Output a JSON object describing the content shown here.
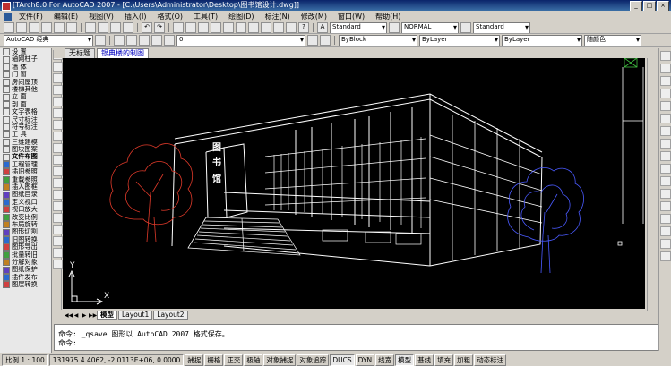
{
  "window": {
    "title": "[TArch8.0 For AutoCAD 2007 - [C:\\Users\\Administrator\\Desktop\\图书馆设计.dwg]]"
  },
  "menu": [
    "文件(F)",
    "编辑(E)",
    "视图(V)",
    "插入(I)",
    "格式(O)",
    "工具(T)",
    "绘图(D)",
    "标注(N)",
    "修改(M)",
    "窗口(W)",
    "帮助(H)"
  ],
  "toolbar1": {
    "text_style": "Standard",
    "dim_style": "NORMAL",
    "table_style": "Standard"
  },
  "toolbar2": {
    "workspace": "AutoCAD 经典",
    "layer": "0",
    "color": "ByBlock",
    "linetype": "ByLayer",
    "lineweight": "ByLayer",
    "plotstyle": "随颜色"
  },
  "doc_tabs": [
    "无标题",
    "银典楼的制图"
  ],
  "sidebar": {
    "items": [
      {
        "label": "设  置",
        "hdr": false
      },
      {
        "label": "轴网柱子",
        "hdr": false
      },
      {
        "label": "墙  体",
        "hdr": false
      },
      {
        "label": "门  窗",
        "hdr": false
      },
      {
        "label": "房间屋顶",
        "hdr": false
      },
      {
        "label": "楼梯其他",
        "hdr": false
      },
      {
        "label": "立  面",
        "hdr": false
      },
      {
        "label": "剖  面",
        "hdr": false
      },
      {
        "label": "文字表格",
        "hdr": false
      },
      {
        "label": "尺寸标注",
        "hdr": false
      },
      {
        "label": "符号标注",
        "hdr": false
      },
      {
        "label": "工  具",
        "hdr": false
      },
      {
        "label": "三维建模",
        "hdr": false
      },
      {
        "label": "图块图案",
        "hdr": false
      },
      {
        "label": "文件布图",
        "hdr": true
      },
      {
        "label": "工程管理",
        "hdr": false
      },
      {
        "label": "插旧参照",
        "hdr": false
      },
      {
        "label": "重载参照",
        "hdr": false
      },
      {
        "label": "插入图框",
        "hdr": false
      },
      {
        "label": "图纸目录",
        "hdr": false
      },
      {
        "label": "定义视口",
        "hdr": false
      },
      {
        "label": "视口放大",
        "hdr": false
      },
      {
        "label": "改变比例",
        "hdr": false
      },
      {
        "label": "布局旋转",
        "hdr": false
      },
      {
        "label": "图形切割",
        "hdr": false
      },
      {
        "label": "旧图转换",
        "hdr": false
      },
      {
        "label": "图形导出",
        "hdr": false
      },
      {
        "label": "批量转旧",
        "hdr": false
      },
      {
        "label": "分解对象",
        "hdr": false
      },
      {
        "label": "图纸保护",
        "hdr": false
      },
      {
        "label": "插件发布",
        "hdr": false
      },
      {
        "label": "图层转换",
        "hdr": false
      }
    ]
  },
  "drawing": {
    "sign_chars": [
      "图",
      "书",
      "馆"
    ],
    "ucs_x": "X",
    "ucs_y": "Y"
  },
  "layout_tabs": [
    "模型",
    "Layout1",
    "Layout2"
  ],
  "command": {
    "line1": "命令: _qsave 图形以 AutoCAD 2007 格式保存。",
    "line2": "命令:"
  },
  "status": {
    "scale": "比例 1 : 100",
    "coords": "131975 4.4062, -2.0113E+06, 0.0000",
    "buttons": [
      {
        "label": "捕捉",
        "on": false
      },
      {
        "label": "栅格",
        "on": false
      },
      {
        "label": "正交",
        "on": false
      },
      {
        "label": "极轴",
        "on": false
      },
      {
        "label": "对象捕捉",
        "on": false
      },
      {
        "label": "对象追踪",
        "on": false
      },
      {
        "label": "DUCS",
        "on": true
      },
      {
        "label": "DYN",
        "on": false
      },
      {
        "label": "线宽",
        "on": false
      },
      {
        "label": "模型",
        "on": true
      },
      {
        "label": "基线",
        "on": false
      },
      {
        "label": "填充",
        "on": false
      },
      {
        "label": "加粗",
        "on": false
      },
      {
        "label": "动态标注",
        "on": false
      }
    ]
  },
  "colors": {
    "canvas_bg": "#000000",
    "building_line": "#ffffff",
    "tree_left": "#e03a2a",
    "tree_right": "#4a5aff",
    "title_gradient_start": "#0a246a"
  }
}
